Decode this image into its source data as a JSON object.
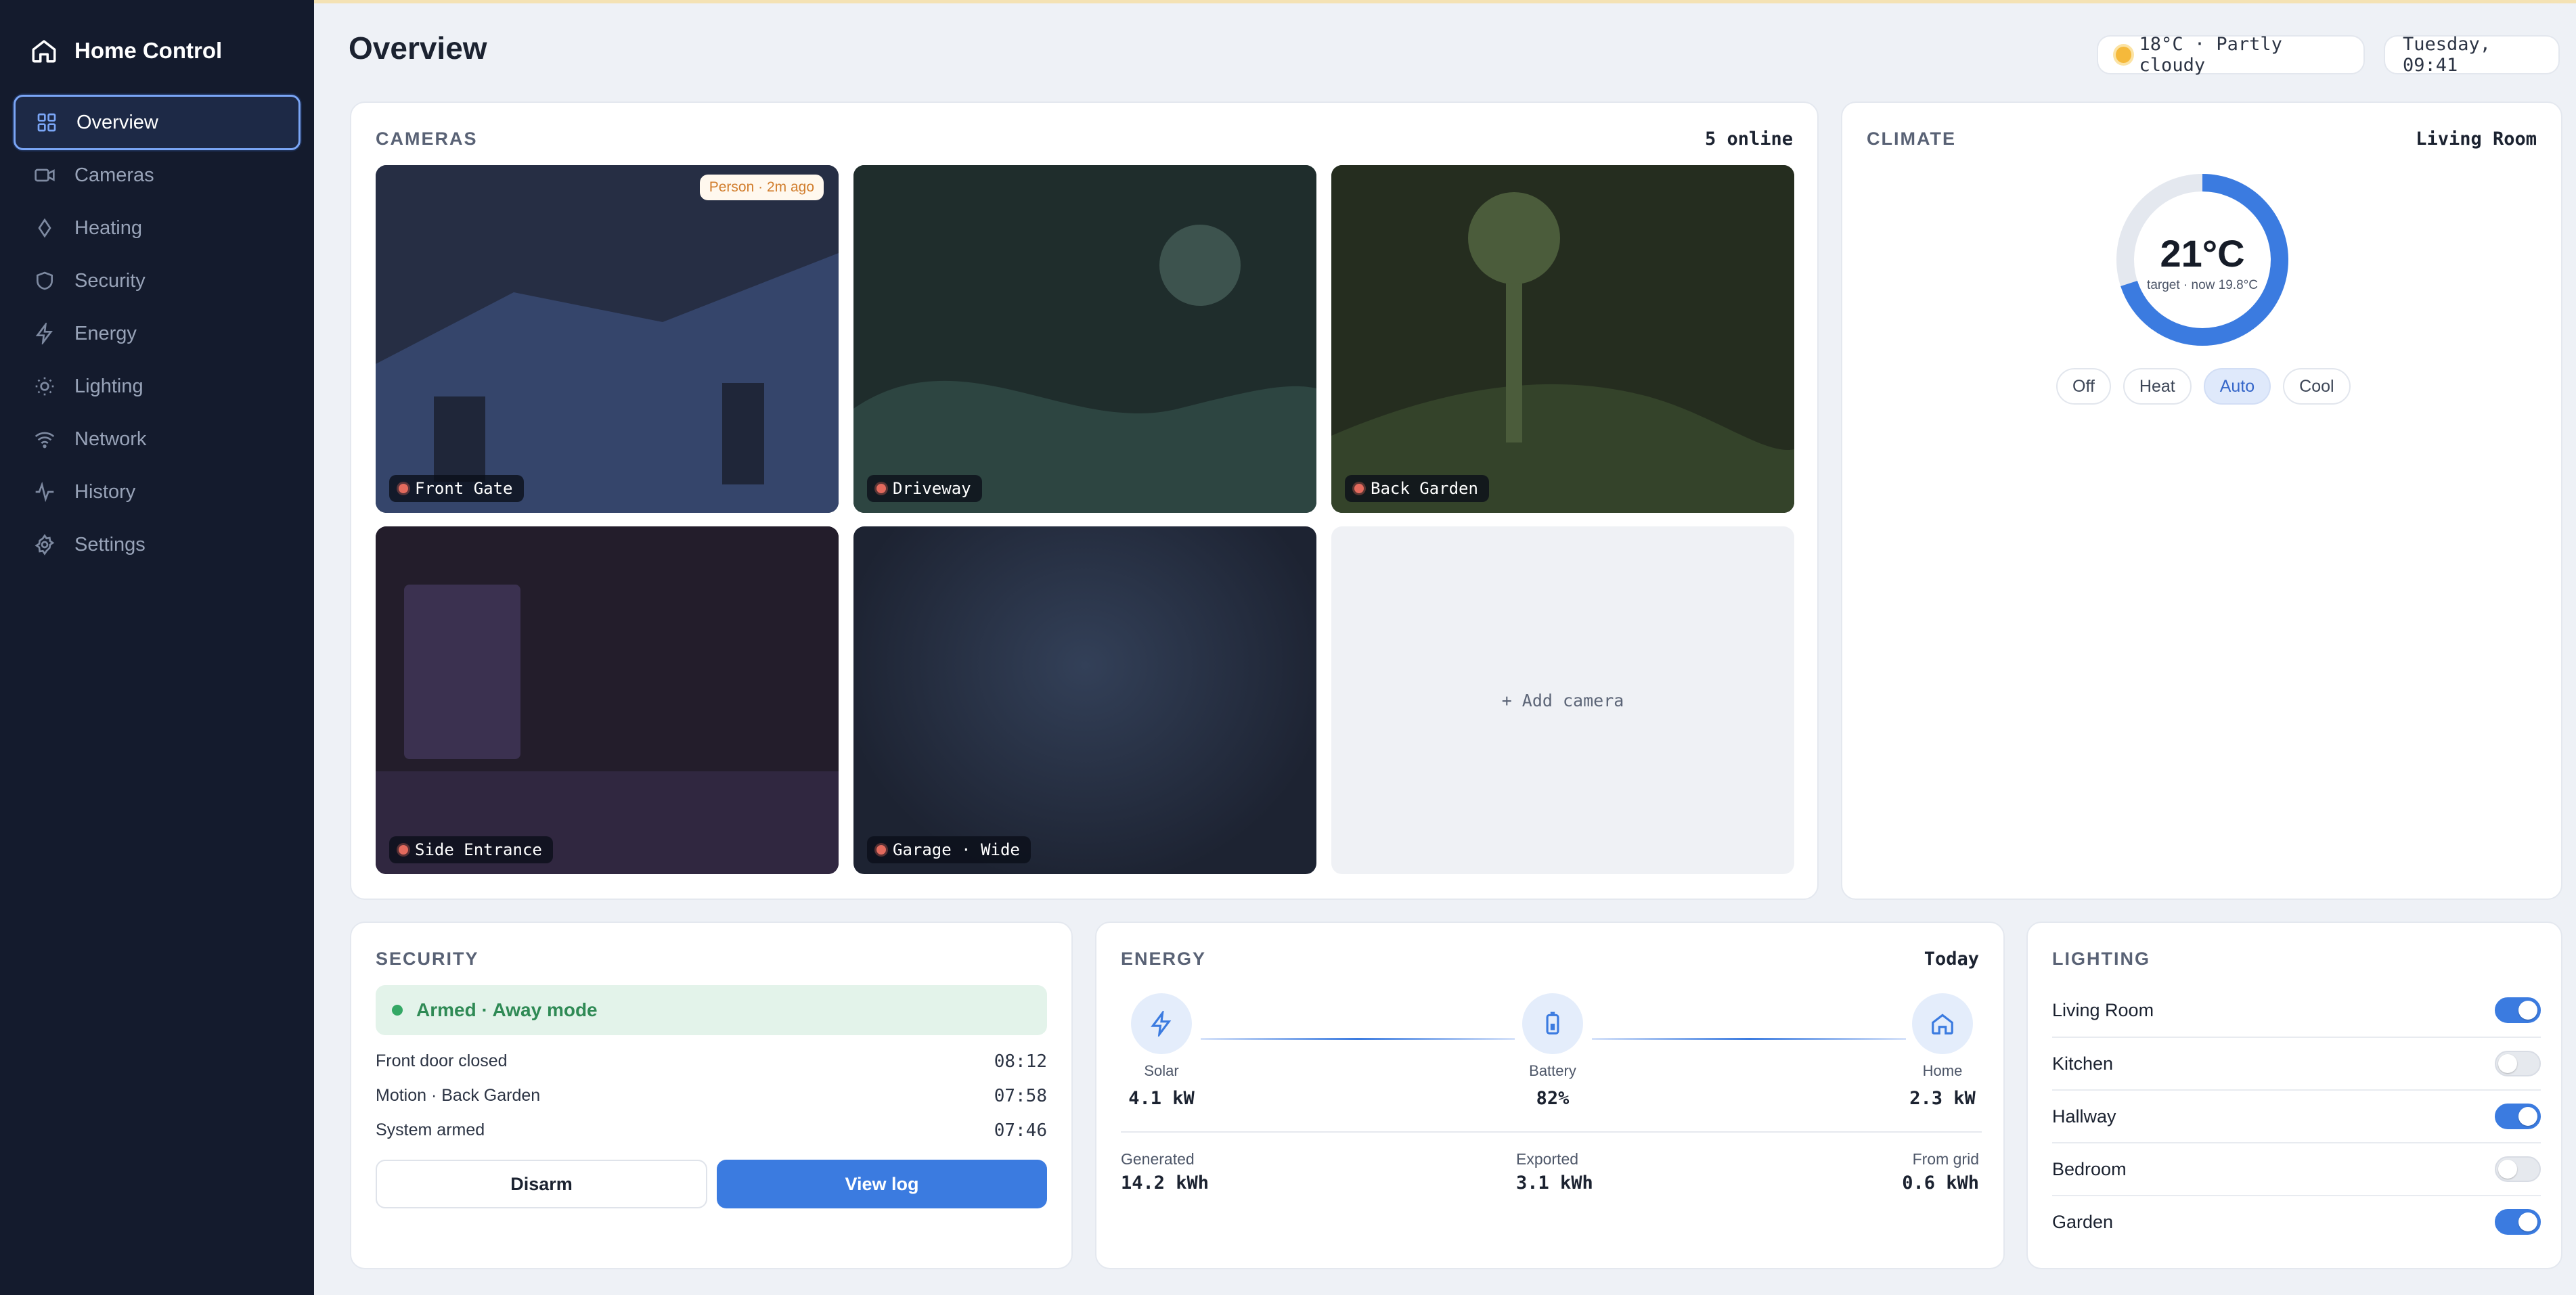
{
  "app": {
    "name": "Home Control"
  },
  "sidebar": {
    "items": [
      {
        "label": "Overview",
        "icon": "grid-icon",
        "active": true
      },
      {
        "label": "Cameras",
        "icon": "video-icon"
      },
      {
        "label": "Heating",
        "icon": "flame-icon"
      },
      {
        "label": "Security",
        "icon": "shield-icon"
      },
      {
        "label": "Energy",
        "icon": "bolt-icon"
      },
      {
        "label": "Lighting",
        "icon": "sun-icon"
      },
      {
        "label": "Network",
        "icon": "wifi-icon"
      },
      {
        "label": "History",
        "icon": "activity-icon"
      },
      {
        "label": "Settings",
        "icon": "gear-icon"
      }
    ]
  },
  "header": {
    "title": "Overview",
    "weather": "18°C · Partly cloudy",
    "datetime": "Tuesday, 09:41"
  },
  "cameras": {
    "title": "CAMERAS",
    "online": "5 online",
    "feeds": [
      {
        "name": "Front Gate",
        "badge": "Person · 2m ago"
      },
      {
        "name": "Driveway"
      },
      {
        "name": "Back Garden"
      },
      {
        "name": "Side Entrance"
      },
      {
        "name": "Garage · Wide"
      }
    ],
    "add_label": "+ Add camera"
  },
  "climate": {
    "title": "CLIMATE",
    "room": "Living Room",
    "target": "21°C",
    "subtext": "target · now 19.8°C",
    "target_fraction": 0.7,
    "modes": [
      "Off",
      "Heat",
      "Auto",
      "Cool"
    ],
    "active_mode": "Auto"
  },
  "security": {
    "title": "SECURITY",
    "status": "Armed · Away mode",
    "events": [
      {
        "label": "Front door closed",
        "time": "08:12"
      },
      {
        "label": "Motion · Back Garden",
        "time": "07:58"
      },
      {
        "label": "System armed",
        "time": "07:46"
      }
    ],
    "disarm_label": "Disarm",
    "view_log_label": "View log"
  },
  "energy": {
    "title": "ENERGY",
    "period": "Today",
    "nodes": [
      {
        "name": "Solar",
        "value": "4.1 kW",
        "icon": "bolt-icon"
      },
      {
        "name": "Battery",
        "value": "82%",
        "icon": "battery-icon"
      },
      {
        "name": "Home",
        "value": "2.3 kW",
        "icon": "home-icon"
      }
    ],
    "stats": [
      {
        "label": "Generated",
        "value": "14.2 kWh"
      },
      {
        "label": "Exported",
        "value": "3.1 kWh"
      },
      {
        "label": "From grid",
        "value": "0.6 kWh"
      }
    ]
  },
  "lighting": {
    "title": "LIGHTING",
    "rooms": [
      {
        "name": "Living Room",
        "on": true
      },
      {
        "name": "Kitchen",
        "on": false
      },
      {
        "name": "Hallway",
        "on": true
      },
      {
        "name": "Bedroom",
        "on": false
      },
      {
        "name": "Garden",
        "on": true
      }
    ]
  },
  "colors": {
    "accent": "#3b7be0",
    "sidebar_bg": "#141b2d",
    "armed_green": "#34a865",
    "alert_orange": "#d17d2c"
  }
}
